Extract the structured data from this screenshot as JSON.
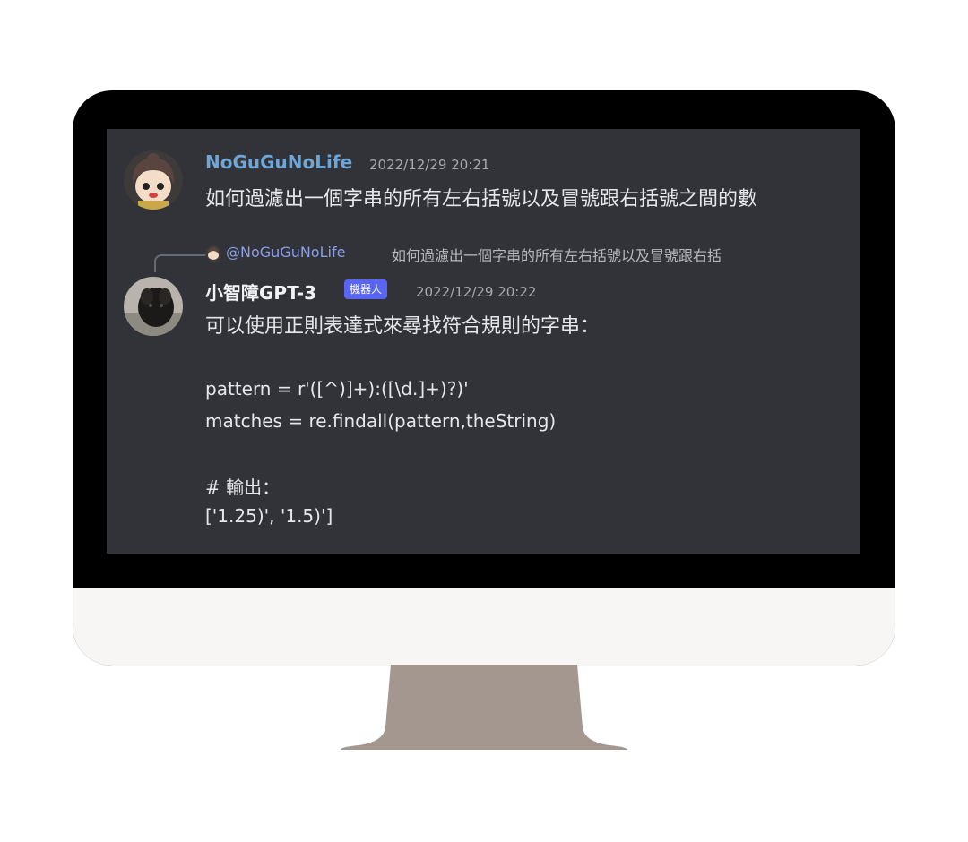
{
  "messages": [
    {
      "username": "NoGuGuNoLife",
      "timestamp": "2022/12/29 20:21",
      "text": "如何過濾出一個字串的所有左右括號以及冒號跟右括號之間的數"
    },
    {
      "reply": {
        "mention": "@NoGuGuNoLife",
        "text": "如何過濾出一個字串的所有左右括號以及冒號跟右括"
      },
      "username": "小智障GPT-3",
      "badge": "機器人",
      "timestamp": "2022/12/29 20:22",
      "lines": [
        "可以使用正則表達式來尋找符合規則的字串：",
        "pattern = r'([^)]+):([\\d.]+)?)'",
        "matches = re.findall(pattern,theString)",
        "# 輸出：",
        "['1.25)', '1.5)']"
      ]
    }
  ],
  "colors": {
    "screen_bg": "#313338",
    "username_user": "#6fa6d6",
    "username_bot": "#f2f3f5",
    "badge_bg": "#5865f2",
    "bezel": "#000000",
    "chin": "#f7f6f4",
    "stand": "#a39790"
  },
  "icons": {
    "user_avatar": "anime-girl-avatar-icon",
    "bot_avatar": "dog-photo-avatar-icon"
  }
}
